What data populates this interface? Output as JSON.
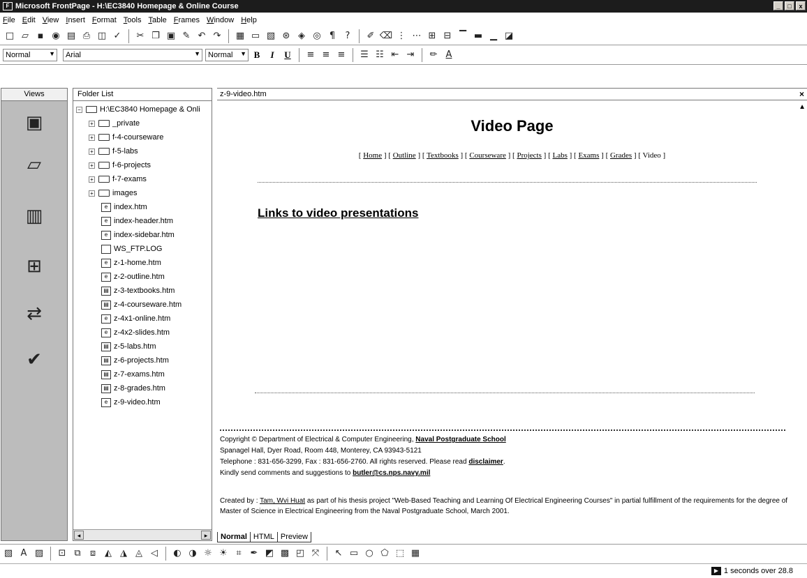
{
  "window": {
    "title": "Microsoft FrontPage - H:\\EC3840 Homepage & Online Course",
    "controls": [
      "_",
      "□",
      "x"
    ]
  },
  "menu": [
    "File",
    "Edit",
    "View",
    "Insert",
    "Format",
    "Tools",
    "Table",
    "Frames",
    "Window",
    "Help"
  ],
  "format_bar": {
    "style": "Normal",
    "font": "Arial",
    "size": "Normal"
  },
  "views": {
    "header": "Views",
    "icons": [
      "page-view-icon",
      "folders-view-icon",
      "reports-view-icon",
      "navigation-view-icon",
      "hyperlinks-view-icon",
      "tasks-view-icon"
    ]
  },
  "folder_list": {
    "header": "Folder List",
    "root": "H:\\EC3840 Homepage & Onli",
    "folders": [
      "_private",
      "f-4-courseware",
      "f-5-labs",
      "f-6-projects",
      "f-7-exams",
      "images"
    ],
    "files": [
      "index.htm",
      "index-header.htm",
      "index-sidebar.htm",
      "WS_FTP.LOG",
      "z-1-home.htm",
      "z-2-outline.htm",
      "z-3-textbooks.htm",
      "z-4-courseware.htm",
      "z-4x1-online.htm",
      "z-4x2-slides.htm",
      "z-5-labs.htm",
      "z-6-projects.htm",
      "z-7-exams.htm",
      "z-8-grades.htm",
      "z-9-video.htm"
    ]
  },
  "editor": {
    "tab": "z-9-video.htm",
    "page_title": "Video Page",
    "nav": [
      "Home",
      "Outline",
      "Textbooks",
      "Courseware",
      "Projects",
      "Labs",
      "Exams",
      "Grades",
      "Video"
    ],
    "heading": "Links to video presentations",
    "footer": {
      "line1_prefix": "Copyright © Department of Electrical & Computer Engineering, ",
      "line1_link": "Naval Postgraduate School",
      "line2": "Spanagel Hall, Dyer Road, Room 448, Monterey, CA 93943-5121",
      "line3_prefix": "Telephone : 831-656-3299, Fax : 831-656-2760.  All rights reserved.  Please read ",
      "line3_link": "disclaimer",
      "line3_suffix": ".",
      "line4_prefix": "Kindly send comments and suggestions to ",
      "line4_link": "butler@cs.nps.navy.mil"
    },
    "created_prefix": "Created by : ",
    "created_link": "Tam, Wvi Huat",
    "created_suffix": " as part of his thesis project \"Web-Based Teaching and Learning Of Electrical Engineering Courses\" in partial fulfillment of the requirements for the degree of Master of Science in Electrical Engineering from the Naval Postgraduate School, March 2001."
  },
  "view_tabs": [
    "Normal",
    "HTML",
    "Preview"
  ],
  "status": {
    "text": "1 seconds over 28.8"
  }
}
